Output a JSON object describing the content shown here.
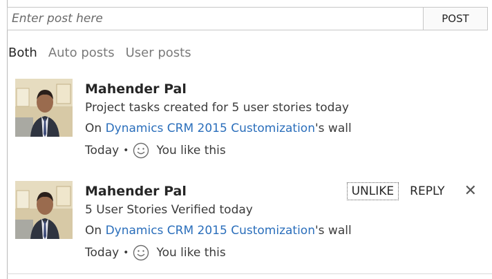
{
  "composer": {
    "placeholder": "Enter post here",
    "post_label": "POST"
  },
  "filters": {
    "tabs": [
      "Both",
      "Auto posts",
      "User posts"
    ],
    "active": "Both"
  },
  "posts": [
    {
      "author": "Mahender Pal",
      "text": "Project tasks created for 5 user stories today",
      "wall_prefix": "On ",
      "wall_link": "Dynamics CRM 2015 Customization",
      "wall_suffix": "'s wall",
      "time": "Today",
      "like_status": "You like this"
    },
    {
      "author": "Mahender Pal",
      "text": "5 User Stories Verified today",
      "wall_prefix": "On ",
      "wall_link": "Dynamics CRM 2015 Customization",
      "wall_suffix": "'s wall",
      "time": "Today",
      "like_status": "You like this",
      "actions": {
        "unlike": "UNLIKE",
        "reply": "REPLY",
        "delete": "✕"
      }
    }
  ],
  "colors": {
    "link": "#2a6ebb",
    "border": "#c6c6c6"
  },
  "icons": {
    "smiley": "smiley-icon",
    "delete": "close-icon"
  }
}
